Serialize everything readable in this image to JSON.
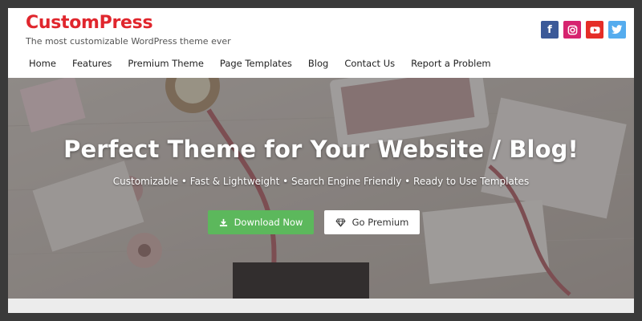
{
  "site": {
    "title": "CustomPress",
    "tagline": "The most customizable WordPress theme ever"
  },
  "social": [
    {
      "name": "facebook",
      "glyph": "f",
      "color": "#3b5998"
    },
    {
      "name": "instagram",
      "glyph": "◎",
      "color": "#d6246f"
    },
    {
      "name": "youtube",
      "glyph": "▶",
      "color": "#e52d27"
    },
    {
      "name": "twitter",
      "glyph": "t",
      "color": "#55acee"
    }
  ],
  "nav": [
    {
      "label": "Home"
    },
    {
      "label": "Features"
    },
    {
      "label": "Premium Theme"
    },
    {
      "label": "Page Templates"
    },
    {
      "label": "Blog"
    },
    {
      "label": "Contact Us"
    },
    {
      "label": "Report a Problem"
    }
  ],
  "hero": {
    "title": "Perfect Theme for Your Website / Blog!",
    "subtitle": "Customizable • Fast & Lightweight • Search Engine Friendly • Ready to Use Templates",
    "download_label": "Download Now",
    "download_icon": "download-icon",
    "premium_label": "Go Premium",
    "premium_icon": "diamond-icon",
    "download_color": "#5cb85c"
  },
  "colors": {
    "brand": "#e0262d",
    "frame": "#3a3a3a"
  }
}
